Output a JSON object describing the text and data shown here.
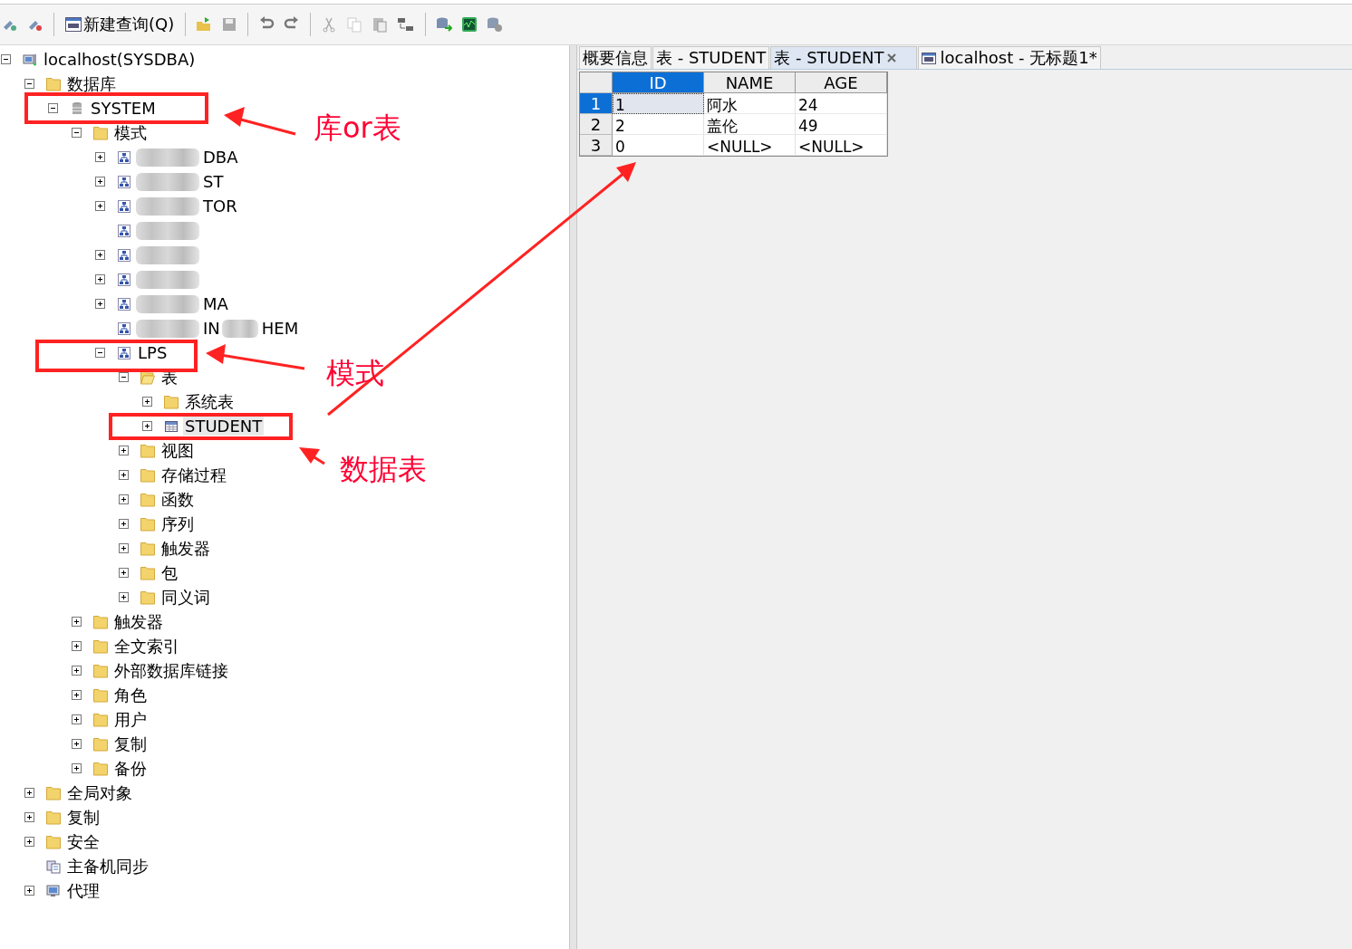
{
  "toolbar": {
    "new_query_button": "新建查询(Q)"
  },
  "tree": [
    {
      "label": "localhost(SYSDBA)",
      "kind": "server",
      "expanded": true,
      "children": [
        {
          "label": "数据库",
          "kind": "folder",
          "expanded": true,
          "children": [
            {
              "label": "SYSTEM",
              "kind": "database",
              "expanded": true,
              "children": [
                {
                  "label": "模式",
                  "kind": "folder",
                  "expanded": true,
                  "children": [
                    {
                      "label": "DBA",
                      "kind": "schema",
                      "expanded": false,
                      "redacted": true
                    },
                    {
                      "label": "ST",
                      "kind": "schema",
                      "expanded": false,
                      "redacted": true
                    },
                    {
                      "label": "TOR",
                      "kind": "schema",
                      "expanded": false,
                      "redacted": true
                    },
                    {
                      "kind": "schema",
                      "redacted": true
                    },
                    {
                      "kind": "schema",
                      "expanded": false,
                      "redacted": true
                    },
                    {
                      "kind": "schema",
                      "expanded": false,
                      "redacted": true
                    },
                    {
                      "label": "MA",
                      "kind": "schema",
                      "expanded": false,
                      "redacted": true
                    },
                    {
                      "prefix": "IN",
                      "label": "HEM",
                      "kind": "schema",
                      "redacted": true
                    },
                    {
                      "label": "LPS",
                      "kind": "schema",
                      "expanded": true,
                      "children": [
                        {
                          "label": "表",
                          "kind": "folder-open",
                          "expanded": true,
                          "children": [
                            {
                              "label": "系统表",
                              "kind": "folder",
                              "expanded": false
                            },
                            {
                              "label": "STUDENT",
                              "kind": "table",
                              "expanded": false,
                              "selected": true
                            }
                          ]
                        },
                        {
                          "label": "视图",
                          "kind": "folder",
                          "expanded": false
                        },
                        {
                          "label": "存储过程",
                          "kind": "folder",
                          "expanded": false
                        },
                        {
                          "label": "函数",
                          "kind": "folder",
                          "expanded": false
                        },
                        {
                          "label": "序列",
                          "kind": "folder",
                          "expanded": false
                        },
                        {
                          "label": "触发器",
                          "kind": "folder",
                          "expanded": false
                        },
                        {
                          "label": "包",
                          "kind": "folder",
                          "expanded": false
                        },
                        {
                          "label": "同义词",
                          "kind": "folder",
                          "expanded": false
                        }
                      ]
                    }
                  ]
                },
                {
                  "label": "触发器",
                  "kind": "folder",
                  "expanded": false
                },
                {
                  "label": "全文索引",
                  "kind": "folder",
                  "expanded": false
                },
                {
                  "label": "外部数据库链接",
                  "kind": "folder",
                  "expanded": false
                },
                {
                  "label": "角色",
                  "kind": "folder",
                  "expanded": false
                },
                {
                  "label": "用户",
                  "kind": "folder",
                  "expanded": false
                },
                {
                  "label": "复制",
                  "kind": "folder",
                  "expanded": false
                },
                {
                  "label": "备份",
                  "kind": "folder",
                  "expanded": false
                }
              ]
            }
          ]
        },
        {
          "label": "全局对象",
          "kind": "folder",
          "expanded": false
        },
        {
          "label": "复制",
          "kind": "folder",
          "expanded": false
        },
        {
          "label": "安全",
          "kind": "folder",
          "expanded": false
        },
        {
          "label": "主备机同步",
          "kind": "sync"
        },
        {
          "label": "代理",
          "kind": "agent",
          "expanded": false
        }
      ]
    }
  ],
  "tabs": [
    {
      "label": "概要信息",
      "selected": false
    },
    {
      "label": "表 - STUDENT",
      "selected": false
    },
    {
      "label": "表 - STUDENT",
      "selected": true,
      "closable": true
    },
    {
      "label": "localhost - 无标题1*",
      "selected": false,
      "sql_icon": true
    }
  ],
  "grid": {
    "columns": [
      {
        "name": "ID",
        "selected": true
      },
      {
        "name": "NAME",
        "selected": false
      },
      {
        "name": "AGE",
        "selected": false
      }
    ],
    "rows": [
      {
        "number": "1",
        "selected": true,
        "cells": [
          "1",
          "阿水",
          "24"
        ]
      },
      {
        "number": "2",
        "selected": false,
        "cells": [
          "2",
          "盖伦",
          "49"
        ]
      },
      {
        "number": "3",
        "selected": false,
        "cells": [
          "0",
          "<NULL>",
          "<NULL>"
        ]
      }
    ]
  },
  "annotations": [
    "库or表",
    "模式",
    "数据表"
  ]
}
